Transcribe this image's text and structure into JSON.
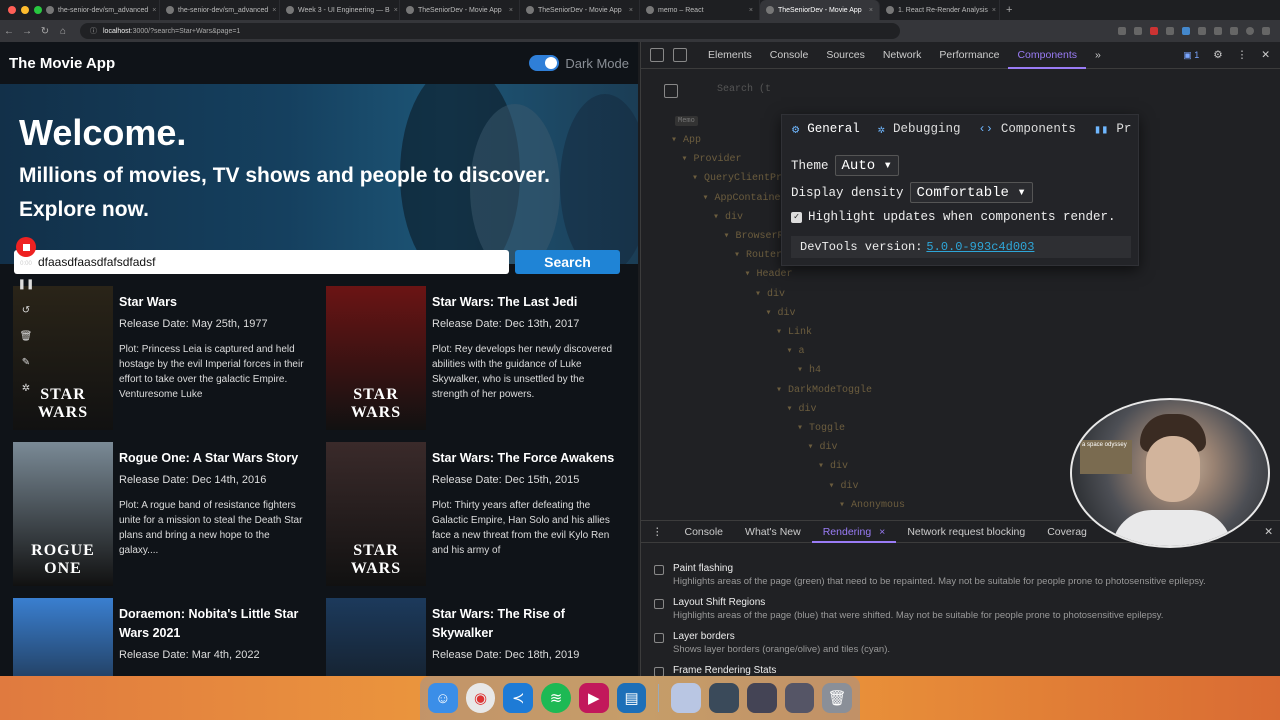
{
  "browser": {
    "tabs": [
      {
        "label": "the-senior-dev/sm_advanced"
      },
      {
        "label": "the-senior-dev/sm_advanced"
      },
      {
        "label": "Week 3 - UI Engineering — B"
      },
      {
        "label": "TheSeniorDev - Movie App"
      },
      {
        "label": "TheSeniorDev - Movie App"
      },
      {
        "label": "memo – React"
      },
      {
        "label": "TheSeniorDev - Movie App"
      },
      {
        "label": "1. React Re-Render Analysis"
      }
    ],
    "active_tab_index": 6,
    "url_host": "localhost",
    "url_rest": ":3000/?search=Star+Wars&page=1"
  },
  "app": {
    "title": "The Movie App",
    "dark_mode_label": "Dark Mode",
    "dark_mode_on": true,
    "hero_title": "Welcome.",
    "hero_subtitle": "Millions of movies, TV shows and people to discover. Explore now.",
    "search_value": "dfaasdfaasdfafsdfadsf",
    "search_button": "Search",
    "recorder_time": "0:00",
    "movies": [
      {
        "title": "Star Wars",
        "date": "Release Date: May 25th, 1977",
        "plot": "Plot: Princess Leia is captured and held hostage by the evil Imperial forces in their effort to take over the galactic Empire. Venturesome Luke",
        "poster_text": "STAR WARS",
        "poster_color": "#2a2418"
      },
      {
        "title": "Star Wars: The Last Jedi",
        "date": "Release Date: Dec 13th, 2017",
        "plot": "Plot: Rey develops her newly discovered abilities with the guidance of Luke Skywalker, who is unsettled by the strength of her powers.",
        "poster_text": "STAR WARS",
        "poster_color": "#6b1414"
      },
      {
        "title": "Rogue One: A Star Wars Story",
        "date": "Release Date: Dec 14th, 2016",
        "plot": "Plot: A rogue band of resistance fighters unite for a mission to steal the Death Star plans and bring a new hope to the galaxy....",
        "poster_text": "ROGUE ONE",
        "poster_color": "#7a8a96"
      },
      {
        "title": "Star Wars: The Force Awakens",
        "date": "Release Date: Dec 15th, 2015",
        "plot": "Plot: Thirty years after defeating the Galactic Empire, Han Solo and his allies face a new threat from the evil Kylo Ren and his army of",
        "poster_text": "STAR WARS",
        "poster_color": "#3a2a2a"
      },
      {
        "title": "Doraemon: Nobita's Little Star Wars 2021",
        "date": "Release Date: Mar 4th, 2022",
        "plot": "",
        "poster_text": "",
        "poster_color": "#3a7fd0"
      },
      {
        "title": "Star Wars: The Rise of Skywalker",
        "date": "Release Date: Dec 18th, 2019",
        "plot": "",
        "poster_text": "",
        "poster_color": "#1c3a5c"
      }
    ]
  },
  "devtools": {
    "tabs": [
      "Elements",
      "Console",
      "Sources",
      "Network",
      "Performance",
      "Components"
    ],
    "active_tab": "Components",
    "issues_count": "1",
    "search_placeholder": "Search (t",
    "memo_label": "Memo",
    "tree": [
      {
        "label": "App",
        "depth": 0
      },
      {
        "label": "Provider",
        "depth": 1
      },
      {
        "label": "QueryClientProvider",
        "depth": 2
      },
      {
        "label": "AppContainer",
        "depth": 3
      },
      {
        "label": "div",
        "depth": 4
      },
      {
        "label": "BrowserRouter",
        "depth": 5
      },
      {
        "label": "Router",
        "depth": 6
      },
      {
        "label": "Header",
        "depth": 7
      },
      {
        "label": "div",
        "depth": 8
      },
      {
        "label": "div",
        "depth": 9
      },
      {
        "label": "Link",
        "depth": 10
      },
      {
        "label": "a",
        "depth": 11
      },
      {
        "label": "h4",
        "depth": 12
      },
      {
        "label": "DarkModeToggle",
        "depth": 10
      },
      {
        "label": "div",
        "depth": 11
      },
      {
        "label": "Toggle",
        "depth": 12
      },
      {
        "label": "div",
        "depth": 13
      },
      {
        "label": "div",
        "depth": 14
      },
      {
        "label": "div",
        "depth": 15
      },
      {
        "label": "Anonymous",
        "depth": 16
      }
    ],
    "settings": {
      "tabs": [
        "General",
        "Debugging",
        "Components",
        "Pr"
      ],
      "active": "General",
      "theme_label": "Theme",
      "theme_value": "Auto",
      "density_label": "Display density",
      "density_value": "Comfortable",
      "highlight_label": "Highlight updates when components render.",
      "highlight_checked": true,
      "version_label": "DevTools version:",
      "version_value": "5.0.0-993c4d003"
    },
    "drawer": {
      "tabs": [
        "Console",
        "What's New",
        "Rendering",
        "Network request blocking",
        "Coverag"
      ],
      "active": "Rendering",
      "options": [
        {
          "title": "Paint flashing",
          "desc": "Highlights areas of the page (green) that need to be repainted. May not be suitable for people prone to photosensitive epilepsy."
        },
        {
          "title": "Layout Shift Regions",
          "desc": "Highlights areas of the page (blue) that were shifted. May not be suitable for people prone to photosensitive epilepsy."
        },
        {
          "title": "Layer borders",
          "desc": "Shows layer borders (orange/olive) and tiles (cyan)."
        },
        {
          "title": "Frame Rendering Stats",
          "desc": ""
        }
      ]
    }
  },
  "webcam": {
    "poster_text": "a space odyssey"
  },
  "dock": [
    "finder-icon",
    "chrome-icon",
    "vscode-icon",
    "spotify-icon",
    "app-icon",
    "linkedin-helper-icon"
  ],
  "colors": {
    "accent": "#1f84d6",
    "devtools_accent": "#9a7cf6",
    "link": "#2ea6d8",
    "record": "#e22222"
  }
}
